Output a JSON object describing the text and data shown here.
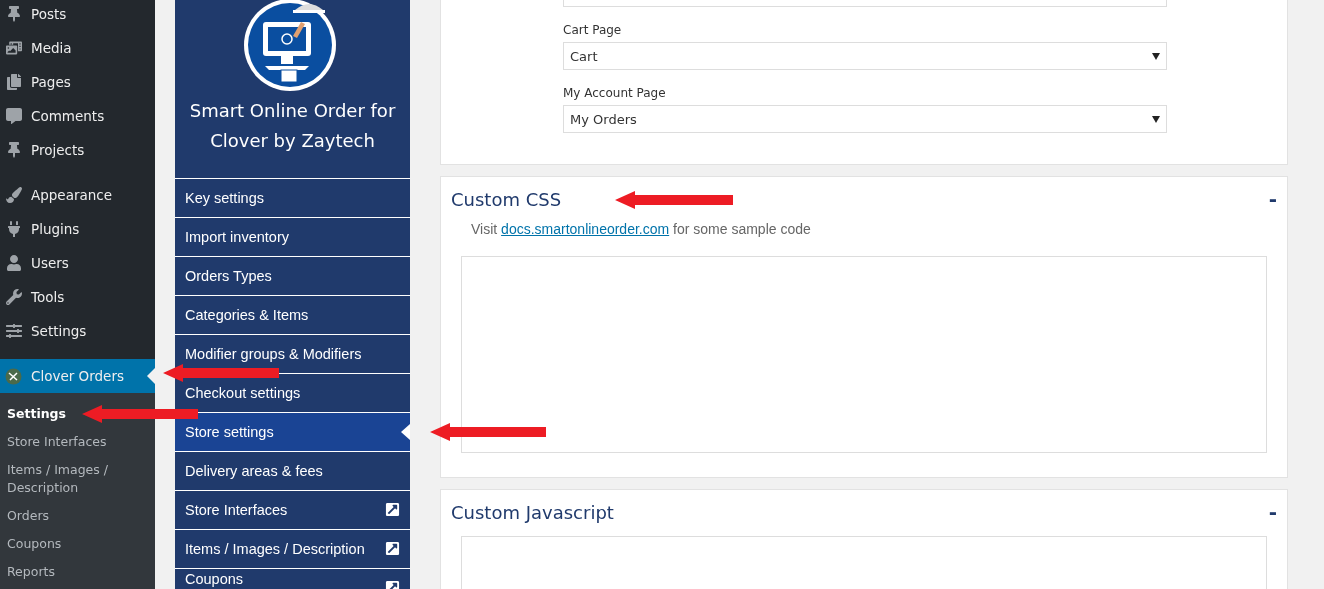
{
  "wp_menu": {
    "groups": [
      [
        {
          "label": "Posts",
          "selected": false
        },
        {
          "label": "Media",
          "selected": false
        },
        {
          "label": "Pages",
          "selected": false
        },
        {
          "label": "Comments",
          "selected": false
        },
        {
          "label": "Projects",
          "selected": false
        }
      ],
      [
        {
          "label": "Appearance",
          "selected": false
        },
        {
          "label": "Plugins",
          "selected": false
        },
        {
          "label": "Users",
          "selected": false
        },
        {
          "label": "Tools",
          "selected": false
        },
        {
          "label": "Settings",
          "selected": false
        }
      ],
      [
        {
          "label": "Clover Orders",
          "selected": true
        }
      ]
    ],
    "submenu": [
      {
        "label": "Settings",
        "selected": true
      },
      {
        "label": "Store Interfaces",
        "selected": false
      },
      {
        "label": "Items / Images / Description",
        "selected": false
      },
      {
        "label": "Orders",
        "selected": false
      },
      {
        "label": "Coupons",
        "selected": false
      },
      {
        "label": "Reports",
        "selected": false
      }
    ]
  },
  "plugin_nav": {
    "title": "Smart Online Order for Clover by Zaytech",
    "items": [
      {
        "label": "Key settings",
        "selected": false,
        "external": false
      },
      {
        "label": "Import inventory",
        "selected": false,
        "external": false
      },
      {
        "label": "Orders Types",
        "selected": false,
        "external": false
      },
      {
        "label": "Categories & Items",
        "selected": false,
        "external": false
      },
      {
        "label": "Modifier groups & Modifiers",
        "selected": false,
        "external": false
      },
      {
        "label": "Checkout settings",
        "selected": false,
        "external": false
      },
      {
        "label": "Store settings",
        "selected": true,
        "external": false
      },
      {
        "label": "Delivery areas & fees",
        "selected": false,
        "external": false
      },
      {
        "label": "Store Interfaces",
        "selected": false,
        "external": true
      },
      {
        "label": "Items / Images / Description",
        "selected": false,
        "external": true
      },
      {
        "label": "Coupons",
        "selected": false,
        "external": true
      }
    ]
  },
  "page_settings": {
    "fields": [
      {
        "label": "Cart Page",
        "value": "Cart"
      },
      {
        "label": "My Account Page",
        "value": "My Orders"
      }
    ]
  },
  "custom_css": {
    "title": "Custom CSS",
    "toggle": "-",
    "note_before": "Visit ",
    "link": "docs.smartonlineorder.com",
    "note_after": " for some sample code"
  },
  "custom_js": {
    "title": "Custom Javascript",
    "toggle": "-"
  }
}
